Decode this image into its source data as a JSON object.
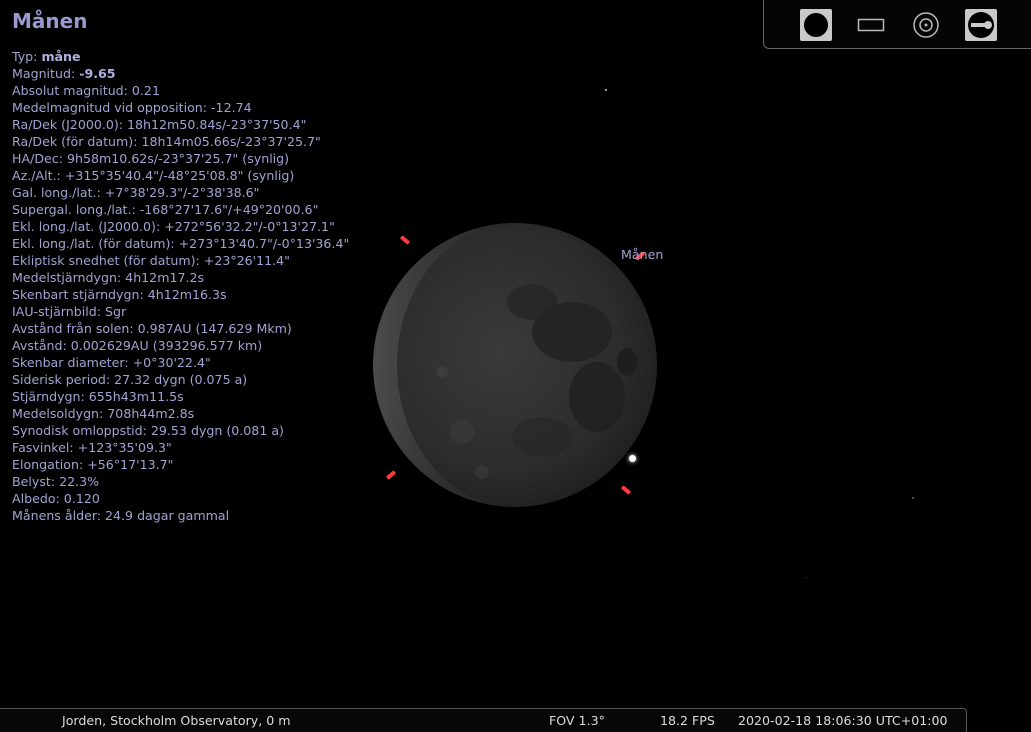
{
  "object": {
    "name": "Månen",
    "label": "Månen"
  },
  "info": [
    {
      "label": "Typ: ",
      "value": "måne",
      "bold": true
    },
    {
      "label": "Magnitud: ",
      "value": "-9.65",
      "bold": true
    },
    {
      "label": "Absolut magnitud: 0.21",
      "value": ""
    },
    {
      "label": "Medelmagnitud vid opposition: -12.74",
      "value": ""
    },
    {
      "label": "Ra/Dek (J2000.0): 18h12m50.84s/-23°37'50.4\"",
      "value": ""
    },
    {
      "label": "Ra/Dek (för datum): 18h14m05.66s/-23°37'25.7\"",
      "value": ""
    },
    {
      "label": "HA/Dec: 9h58m10.62s/-23°37'25.7\" (synlig)",
      "value": ""
    },
    {
      "label": "Az./Alt.: +315°35'40.4\"/-48°25'08.8\" (synlig)",
      "value": ""
    },
    {
      "label": "Gal. long./lat.: +7°38'29.3\"/-2°38'38.6\"",
      "value": ""
    },
    {
      "label": "Supergal. long./lat.: -168°27'17.6\"/+49°20'00.6\"",
      "value": ""
    },
    {
      "label": "Ekl. long./lat. (J2000.0): +272°56'32.2\"/-0°13'27.1\"",
      "value": ""
    },
    {
      "label": "Ekl. long./lat. (för datum): +273°13'40.7\"/-0°13'36.4\"",
      "value": ""
    },
    {
      "label": "Ekliptisk snedhet (för datum): +23°26'11.4\"",
      "value": ""
    },
    {
      "label": "Medelstjärndygn: 4h12m17.2s",
      "value": ""
    },
    {
      "label": "Skenbart stjärndygn: 4h12m16.3s",
      "value": ""
    },
    {
      "label": "IAU-stjärnbild: Sgr",
      "value": ""
    },
    {
      "label": "Avstånd från solen: 0.987AU (147.629 Mkm)",
      "value": ""
    },
    {
      "label": "Avstånd: 0.002629AU (393296.577 km)",
      "value": ""
    },
    {
      "label": "Skenbar diameter: +0°30'22.4\"",
      "value": ""
    },
    {
      "label": "Siderisk period: 27.32 dygn (0.075 a)",
      "value": ""
    },
    {
      "label": "Stjärndygn: 655h43m11.5s",
      "value": ""
    },
    {
      "label": "Medelsoldygn: 708h44m2.8s",
      "value": ""
    },
    {
      "label": "Synodisk omloppstid: 29.53 dygn (0.081 a)",
      "value": ""
    },
    {
      "label": "Fasvinkel: +123°35'09.3\"",
      "value": ""
    },
    {
      "label": "Elongation: +56°17'13.7\"",
      "value": ""
    },
    {
      "label": "Belyst: 22.3%",
      "value": ""
    },
    {
      "label": "Albedo: 0.120",
      "value": ""
    },
    {
      "label": "Månens ålder: 24.9 dagar gammal",
      "value": ""
    }
  ],
  "toolbar": {
    "buttons": [
      {
        "icon": "filled-circle-icon",
        "active": true
      },
      {
        "icon": "rectangle-icon",
        "active": false
      },
      {
        "icon": "target-icon",
        "active": false
      },
      {
        "icon": "ocular-settings-icon",
        "active": true
      }
    ]
  },
  "status": {
    "location": "Jorden, Stockholm Observatory, 0 m",
    "fov": "FOV 1.3°",
    "fps": "18.2 FPS",
    "datetime": "2020-02-18 18:06:30 UTC+01:00"
  },
  "colors": {
    "text": "#a2a2d2",
    "marker": "#ff3a3a",
    "background": "#000000"
  }
}
